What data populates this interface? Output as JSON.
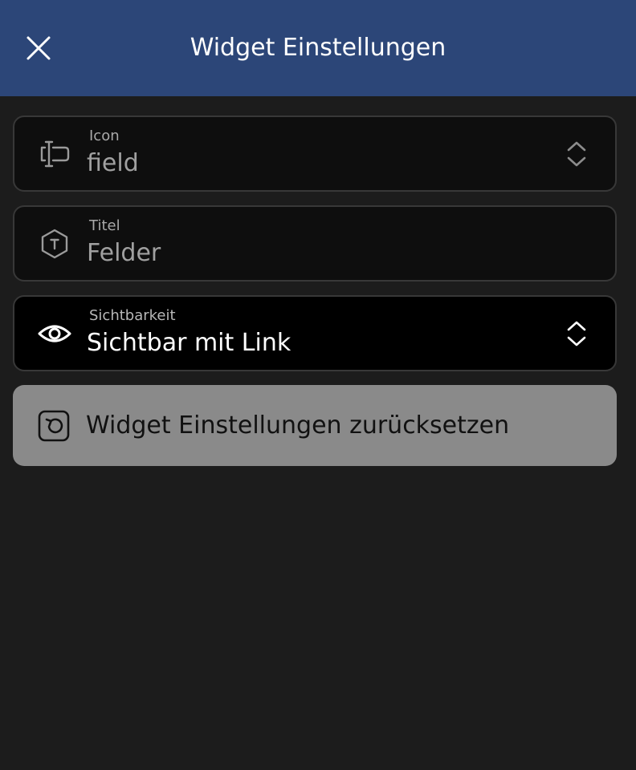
{
  "header": {
    "title": "Widget Einstellungen",
    "background_color": "#2c4678",
    "close_icon": "close-icon"
  },
  "fields": {
    "icon": {
      "label": "Icon",
      "value": "field",
      "icon": "field-icon",
      "control_icon": "chevron-up-down-icon"
    },
    "title": {
      "label": "Titel",
      "value": "Felder",
      "icon": "text-hexagon-icon"
    },
    "visibility": {
      "label": "Sichtbarkeit",
      "value": "Sichtbar mit Link",
      "icon": "eye-icon",
      "control_icon": "chevron-up-down-icon"
    }
  },
  "reset": {
    "label": "Widget Einstellungen zurücksetzen",
    "icon": "reset-icon",
    "background_color": "#8a8a8a"
  },
  "colors": {
    "page_background": "#1c1c1c",
    "field_background": "#0e0e0e",
    "field_border": "#383838"
  }
}
